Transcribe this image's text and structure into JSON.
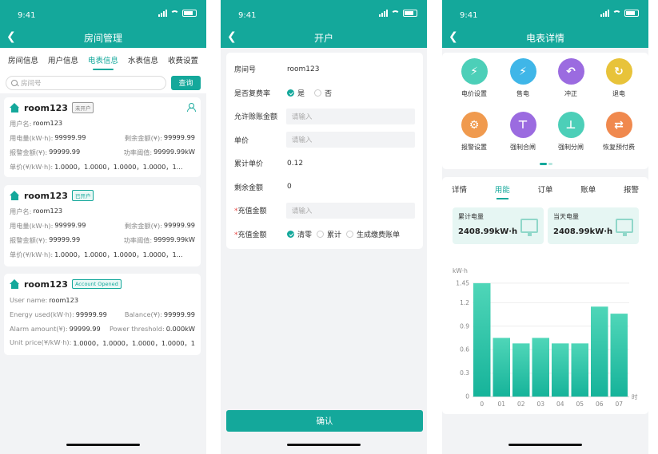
{
  "status_time": "9:41",
  "panel1": {
    "title": "房间管理",
    "tabs": [
      "房间信息",
      "用户信息",
      "电表信息",
      "水表信息",
      "收费设置"
    ],
    "active_tab": 2,
    "search_placeholder": "房间号",
    "search_button": "查询",
    "cards": [
      {
        "room": "room123",
        "badge": "未开户",
        "user_label": "用户名:",
        "user": "room123",
        "energy_label": "用电量(kW·h):",
        "energy": "99999.99",
        "balance_label": "剩余金额(¥):",
        "balance": "99999.99",
        "alarm_label": "报警金额(¥):",
        "alarm": "99999.99",
        "power_label": "功率阈值:",
        "power": "99999.99kW",
        "price_label": "单价(¥/kW·h):",
        "price": "1.0000，1.0000，1.0000，1.0000，1..."
      },
      {
        "room": "room123",
        "badge": "已开户",
        "user_label": "用户名:",
        "user": "room123",
        "energy_label": "用电量(kW·h):",
        "energy": "99999.99",
        "balance_label": "剩余金额(¥):",
        "balance": "99999.99",
        "alarm_label": "报警金额(¥):",
        "alarm": "99999.99",
        "power_label": "功率阈值:",
        "power": "99999.99kW",
        "price_label": "单价(¥/kW·h):",
        "price": "1.0000，1.0000，1.0000，1.0000，1..."
      },
      {
        "room": "room123",
        "badge": "Account Opened",
        "user_label": "User name:",
        "user": "room123",
        "energy_label": "Energy used(kW·h):",
        "energy": "99999.99",
        "balance_label": "Balance(¥):",
        "balance": "99999.99",
        "alarm_label": "Alarm amount(¥):",
        "alarm": "99999.99",
        "power_label": "Power threshold:",
        "power": "0.000kW",
        "price_label": "Unit price(¥/kW·h):",
        "price": "1.0000，1.0000，1.0000，1.0000，1..."
      }
    ]
  },
  "panel2": {
    "title": "开户",
    "room_label": "房间号",
    "room_value": "room123",
    "reuse_label": "是否复费率",
    "yes": "是",
    "no": "否",
    "allow_label": "允许赊账金额",
    "input_placeholder": "请输入",
    "price_label": "单价",
    "cum_price_label": "累计单价",
    "cum_price_value": "0.12",
    "remain_label": "剩余金额",
    "remain_value": "0",
    "recharge_label": "充值金额",
    "recharge2_label": "充值金额",
    "opt_clear": "清零",
    "opt_accumulate": "累计",
    "opt_bill": "生成缴费账单",
    "confirm": "确认"
  },
  "panel3": {
    "title": "电表详情",
    "actions": [
      {
        "label": "电价设置",
        "icon": "lightning-circle-icon",
        "color": "#4ccfb8"
      },
      {
        "label": "售电",
        "icon": "lightning-icon",
        "color": "#3fb6e8"
      },
      {
        "label": "冲正",
        "icon": "reverse-icon",
        "color": "#9b6be0"
      },
      {
        "label": "退电",
        "icon": "lightning-return-icon",
        "color": "#e8c33a"
      },
      {
        "label": "报警设置",
        "icon": "alarm-icon",
        "color": "#f09a4e"
      },
      {
        "label": "强制合闸",
        "icon": "switch-close-icon",
        "color": "#9b6be0"
      },
      {
        "label": "强制分闸",
        "icon": "switch-open-icon",
        "color": "#4ccfb8"
      },
      {
        "label": "恢复预付费",
        "icon": "restore-icon",
        "color": "#f0894e"
      }
    ],
    "tabs": [
      "详情",
      "用能",
      "订单",
      "账单",
      "报警"
    ],
    "active_tab": 1,
    "stat1_label": "累计电量",
    "stat1_value": "2408.99kW·h",
    "stat2_label": "当天电量",
    "stat2_value": "2408.99kW·h",
    "accent": "#14a89b"
  },
  "chart_data": {
    "type": "bar",
    "ylabel": "kW·h",
    "xlabel": "时",
    "categories": [
      "0",
      "01",
      "02",
      "03",
      "04",
      "05",
      "06",
      "07"
    ],
    "values": [
      1.45,
      0.75,
      0.68,
      0.75,
      0.68,
      0.68,
      1.15,
      1.06
    ],
    "yticks": [
      "0",
      "0.3",
      "0.6",
      "0.9",
      "1.2",
      "1.45"
    ],
    "ylim": [
      0,
      1.5
    ]
  }
}
